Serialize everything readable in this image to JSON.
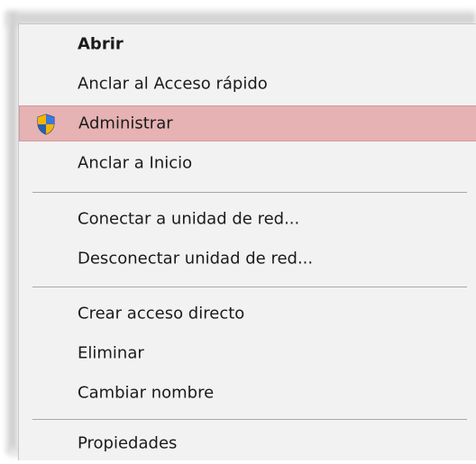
{
  "context_menu": {
    "items": [
      {
        "label": "Abrir"
      },
      {
        "label": "Anclar al Acceso rápido"
      },
      {
        "label": "Administrar",
        "icon": "uac-shield-icon"
      },
      {
        "label": "Anclar a Inicio"
      },
      {
        "label": "Conectar a unidad de red..."
      },
      {
        "label": "Desconectar unidad de red..."
      },
      {
        "label": "Crear acceso directo"
      },
      {
        "label": "Eliminar"
      },
      {
        "label": "Cambiar nombre"
      },
      {
        "label": "Propiedades"
      }
    ]
  },
  "colors": {
    "menu_background": "#f2f2f2",
    "highlight_background": "#e6b2b3",
    "text": "#1b1b1b",
    "separator": "#a8a8a8"
  }
}
